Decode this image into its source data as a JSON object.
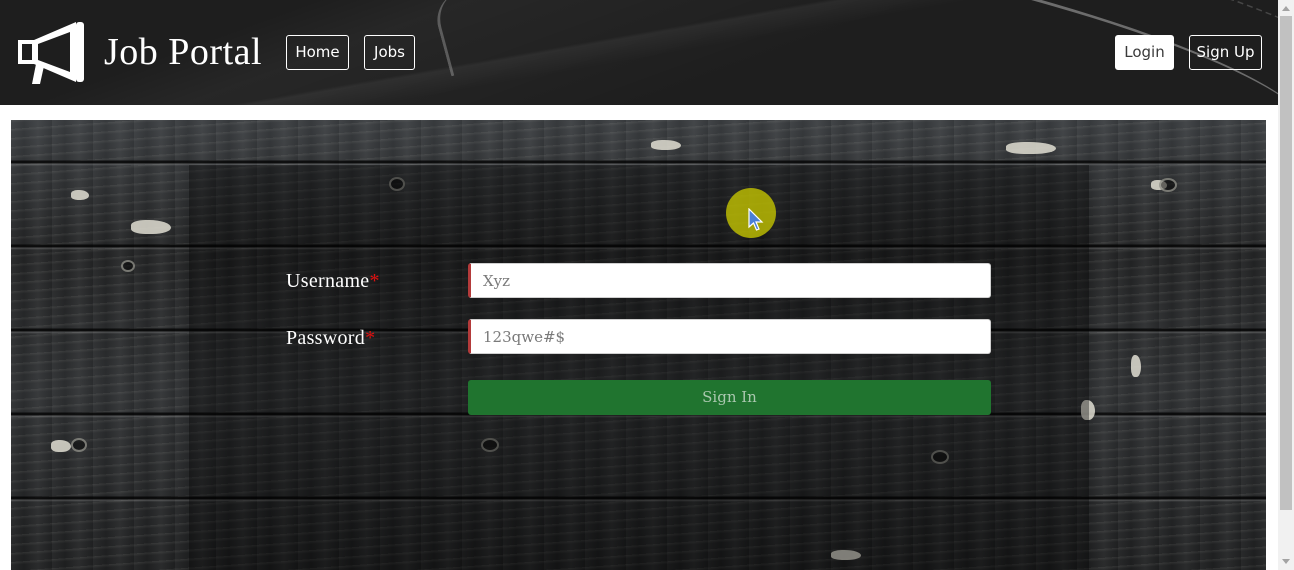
{
  "brand": {
    "name": "Job Portal",
    "icon": "megaphone-icon"
  },
  "nav": {
    "home": "Home",
    "jobs": "Jobs",
    "login": "Login",
    "signup": "Sign Up"
  },
  "form": {
    "username_label": "Username",
    "password_label": "Password",
    "required_marker": "*",
    "username_placeholder": "Xyz",
    "password_placeholder": "123qwe#$",
    "submit_label": "Sign In"
  },
  "colors": {
    "navbar": "#1e1e1e",
    "signin_button": "#20742f",
    "required_marker": "#e01010",
    "input_accent": "#b33a3a"
  }
}
